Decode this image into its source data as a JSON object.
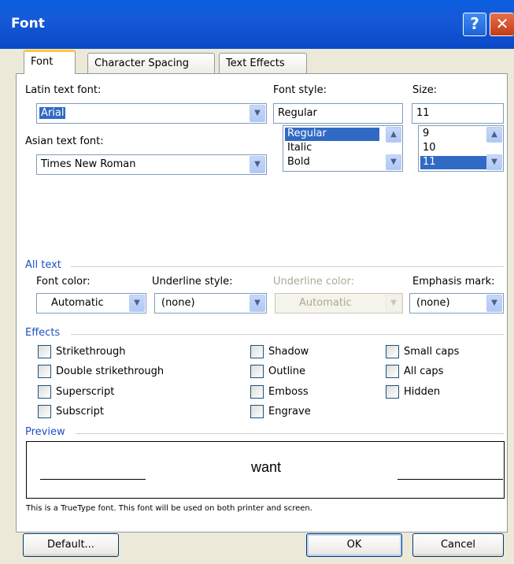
{
  "title": "Font",
  "titlebar": {
    "help": "?",
    "close": "✕"
  },
  "tabs": [
    "Font",
    "Character Spacing",
    "Text Effects"
  ],
  "latin_font": {
    "label": "Latin text font:",
    "value": "Arial"
  },
  "font_style": {
    "label": "Font style:",
    "value": "Regular",
    "options": [
      "Regular",
      "Italic",
      "Bold"
    ],
    "selected": "Regular"
  },
  "size": {
    "label": "Size:",
    "value": "11",
    "options": [
      "9",
      "10",
      "11"
    ],
    "selected": "11"
  },
  "asian_font": {
    "label": "Asian text font:",
    "value": "Times New Roman"
  },
  "all_text": {
    "section": "All text",
    "font_color": {
      "label": "Font color:",
      "value": "Automatic"
    },
    "underline_style": {
      "label": "Underline style:",
      "value": "(none)"
    },
    "underline_color": {
      "label": "Underline color:",
      "value": "Automatic"
    },
    "emphasis_mark": {
      "label": "Emphasis mark:",
      "value": "(none)"
    }
  },
  "effects": {
    "section": "Effects",
    "col1": [
      "Strikethrough",
      "Double strikethrough",
      "Superscript",
      "Subscript"
    ],
    "col2": [
      "Shadow",
      "Outline",
      "Emboss",
      "Engrave"
    ],
    "col3": [
      "Small caps",
      "All caps",
      "Hidden"
    ]
  },
  "preview": {
    "section": "Preview",
    "text": "want"
  },
  "note": "This is a TrueType font. This font will be used on both printer and screen.",
  "buttons": {
    "default": "Default...",
    "ok": "OK",
    "cancel": "Cancel"
  },
  "colors": {
    "titlebar": "#0a5fe0",
    "section": "#1d50c4",
    "selection": "#316ac5",
    "dialog_bg": "#ece9d8"
  }
}
